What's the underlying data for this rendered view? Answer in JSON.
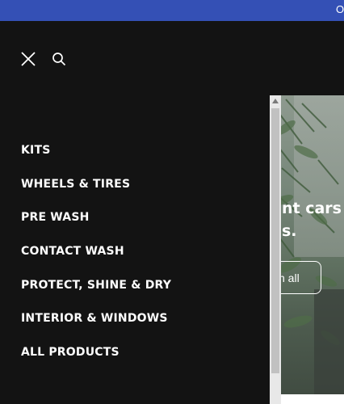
{
  "announcement": {
    "text": "O"
  },
  "drawer": {
    "icons": {
      "close": "close-icon",
      "search": "search-icon"
    },
    "menu_items": [
      {
        "label": "KITS"
      },
      {
        "label": "WHEELS & TIRES"
      },
      {
        "label": "PRE WASH"
      },
      {
        "label": "CONTACT WASH"
      },
      {
        "label": "PROTECT, SHINE & DRY"
      },
      {
        "label": "INTERIOR & WINDOWS"
      },
      {
        "label": "ALL PRODUCTS"
      }
    ]
  },
  "hero": {
    "heading_line1": "nt cars s",
    "heading_line2": "s.",
    "button_label": "n all"
  },
  "colors": {
    "announcement_bg": "#3450b5",
    "drawer_bg": "#131313",
    "text": "#ffffff",
    "scrollbar_track": "#e8e8e8",
    "scrollbar_thumb": "#c1c1c1"
  }
}
